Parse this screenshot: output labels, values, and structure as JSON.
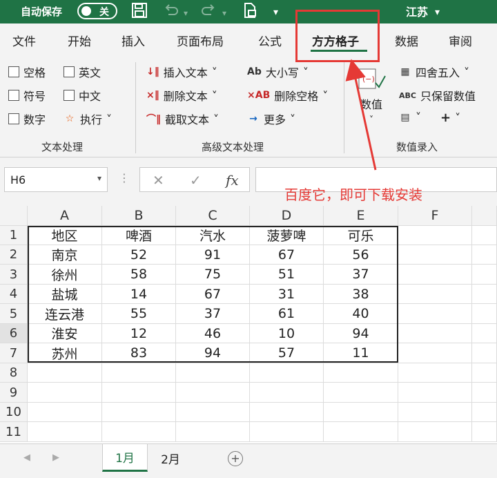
{
  "titlebar": {
    "autosave_label": "自动保存",
    "toggle_state": "关",
    "account": "江苏",
    "account_chevron": "▾",
    "more_chevron": "▾",
    "icons": [
      "save-icon",
      "undo-icon",
      "redo-icon",
      "print-icon",
      "more-icon"
    ],
    "color": "#1f7345"
  },
  "menu": {
    "tabs": [
      "文件",
      "开始",
      "插入",
      "页面布局",
      "公式",
      "方方格子",
      "数据",
      "审阅"
    ],
    "active_tab": "方方格子"
  },
  "ribbon": {
    "text_group": {
      "checkboxes": [
        "空格",
        "英文",
        "符号",
        "中文",
        "数字"
      ],
      "exec_label": "执行",
      "group_label": "文本处理"
    },
    "advanced_group": {
      "insert_text": "插入文本",
      "delete_text": "删除文本",
      "extract_text": "截取文本",
      "case": "大小写",
      "delete_space": "删除空格",
      "more": "更多",
      "group_label": "高级文本处理"
    },
    "numeric_group": {
      "value_label": "数值",
      "round": "四舍五入",
      "keep_numeric": "只保留数值",
      "group_label": "数值录入"
    },
    "chevron": "˅"
  },
  "formula_bar": {
    "name_box": "H6",
    "name_box_chevron": "▾",
    "dots": "⋮",
    "cancel": "✕",
    "confirm": "✓",
    "fx": "fx",
    "formula": ""
  },
  "annotation": {
    "text": "百度它，即可下载安装",
    "color": "#e53935"
  },
  "sheet": {
    "columns": [
      "A",
      "B",
      "C",
      "D",
      "E",
      "F"
    ],
    "rows": [
      "1",
      "2",
      "3",
      "4",
      "5",
      "6",
      "7",
      "8",
      "9",
      "10",
      "11"
    ],
    "selected_row": "6",
    "header": [
      "地区",
      "啤酒",
      "汽水",
      "菠萝啤",
      "可乐"
    ],
    "data": [
      [
        "南京",
        "52",
        "91",
        "67",
        "56"
      ],
      [
        "徐州",
        "58",
        "75",
        "51",
        "37"
      ],
      [
        "盐城",
        "14",
        "67",
        "31",
        "38"
      ],
      [
        "连云港",
        "55",
        "37",
        "61",
        "40"
      ],
      [
        "淮安",
        "12",
        "46",
        "10",
        "94"
      ],
      [
        "苏州",
        "83",
        "94",
        "57",
        "11"
      ]
    ]
  },
  "statusbar": {
    "sheets": [
      "1月",
      "2月"
    ],
    "active_sheet": "1月",
    "nav_prev": "◀",
    "nav_next": "▶",
    "add": "+"
  }
}
